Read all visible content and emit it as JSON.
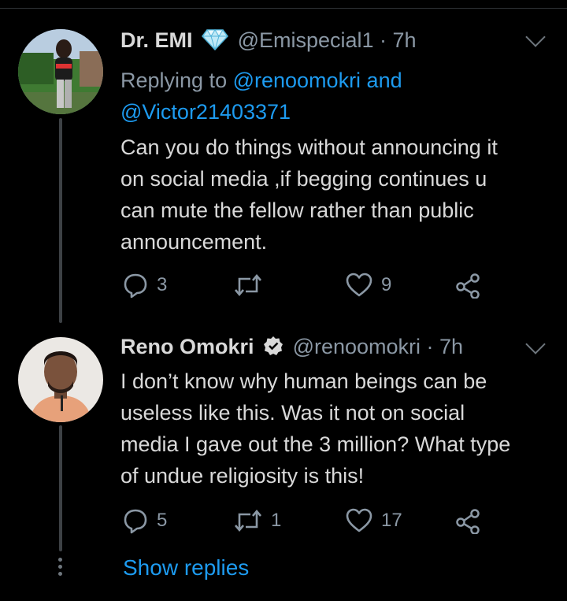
{
  "tweets": [
    {
      "name": "Dr. EMI",
      "badge_icon": "diamond-icon",
      "handle_time": "@Emispecial1 · 7h",
      "replying_prefix": "Replying to ",
      "replying_users": "@renoomokri and",
      "replying_users_2": "@Victor21403371",
      "text_lines": [
        "Can you do things without announcing it",
        "on social media ,if begging continues u",
        "can mute the fellow rather than public",
        "announcement."
      ],
      "replies": "3",
      "retweets": "",
      "likes": "9"
    },
    {
      "name": "Reno Omokri",
      "badge_icon": "verified-icon",
      "handle_time": "@renoomokri · 7h",
      "text_lines": [
        "I don’t know why human beings can be",
        "useless like this. Was it not on social",
        "media I gave out the 3 million? What type",
        "of undue religiosity is this!"
      ],
      "replies": "5",
      "retweets": "1",
      "likes": "17"
    }
  ],
  "show_replies": "Show replies",
  "colors": {
    "background": "#000000",
    "text": "#d9d9d9",
    "muted": "#8b98a5",
    "link": "#1d9bf0"
  }
}
